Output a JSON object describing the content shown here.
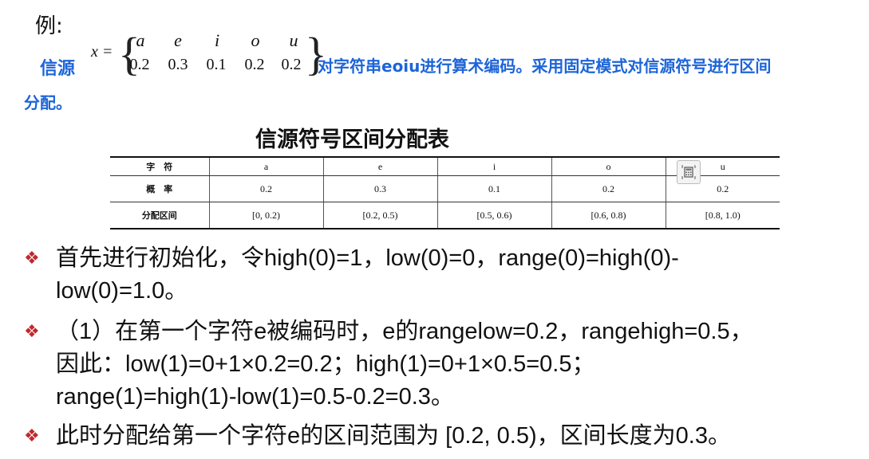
{
  "intro": {
    "example": "例:",
    "source_label": "信源",
    "x_eq": "x =",
    "symbols": [
      "a",
      "e",
      "i",
      "o",
      "u"
    ],
    "probabilities": [
      "0.2",
      "0.3",
      "0.1",
      "0.2",
      "0.2"
    ],
    "line1_rest": "对字符串eoiu进行算术编码。采用固定模式对信源符号进行区间",
    "line2": "分配。"
  },
  "table": {
    "title": "信源符号区间分配表",
    "row_labels": [
      "字　符",
      "概　率",
      "分配区间"
    ],
    "symbols": [
      "a",
      "e",
      "i",
      "o",
      "u"
    ],
    "probabilities": [
      "0.2",
      "0.3",
      "0.1",
      "0.2",
      "0.2"
    ],
    "intervals": [
      "[0, 0.2)",
      "[0.2, 0.5)",
      "[0.5, 0.6)",
      "[0.6, 0.8)",
      "[0.8, 1.0)"
    ]
  },
  "bullets": [
    {
      "lines": [
        "首先进行初始化，令high(0)=1，low(0)=0，range(0)=high(0)-",
        "low(0)=1.0。"
      ]
    },
    {
      "lines": [
        "（1）在第一个字符e被编码时，e的rangelow=0.2，rangehigh=0.5，",
        "因此：low(1)=0+1×0.2=0.2；high(1)=0+1×0.5=0.5；",
        "range(1)=high(1)-low(1)=0.5-0.2=0.3。"
      ]
    },
    {
      "lines": [
        "此时分配给第一个字符e的区间范围为 [0.2, 0.5)，区间长度为0.3。"
      ]
    }
  ],
  "colors": {
    "accent": "#1d64d8",
    "bullet": "#c0282d"
  },
  "icons": {
    "bullet": "diamond-bullet-icon",
    "overlay": "calculator-icon"
  }
}
